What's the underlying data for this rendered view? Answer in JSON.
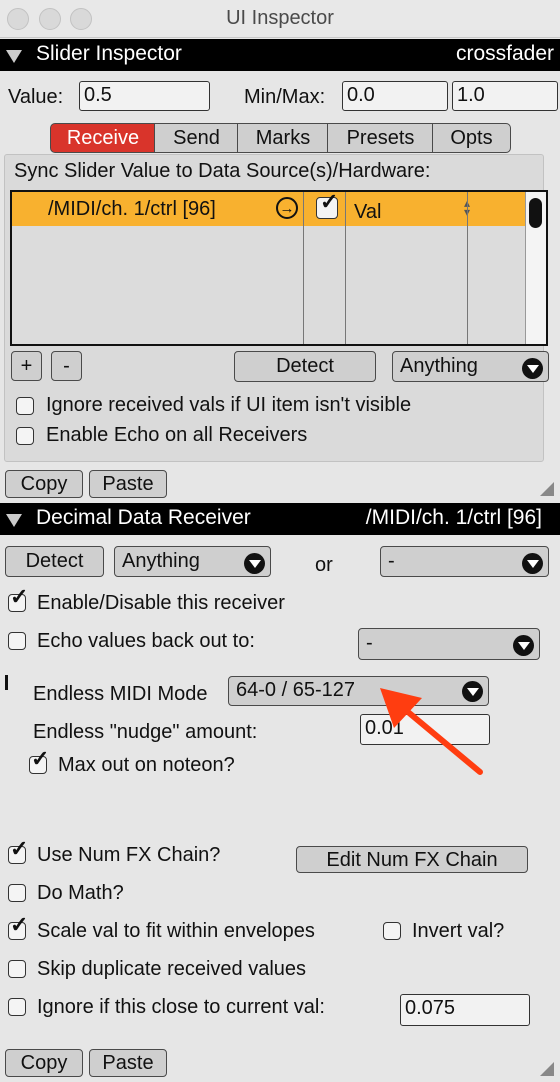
{
  "window": {
    "title": "UI Inspector"
  },
  "slider_inspector": {
    "title": "Slider Inspector",
    "target": "crossfader",
    "value_label": "Value:",
    "value": "0.5",
    "minmax_label": "Min/Max:",
    "min": "0.0",
    "max": "1.0",
    "tabs": [
      "Receive",
      "Send",
      "Marks",
      "Presets",
      "Opts"
    ],
    "selected_tab": "Receive",
    "sync_label": "Sync Slider Value to Data Source(s)/Hardware:",
    "receivers": [
      {
        "source": "/MIDI/ch. 1/ctrl [96]",
        "enabled": true,
        "mode": "Val"
      }
    ],
    "add_label": "+",
    "remove_label": "-",
    "detect_label": "Detect",
    "filter_value": "Anything",
    "ignore_hidden_label": "Ignore received vals if UI item isn't visible",
    "ignore_hidden": false,
    "echo_all_label": "Enable Echo on all Receivers",
    "echo_all": false,
    "copy_label": "Copy",
    "paste_label": "Paste"
  },
  "receiver": {
    "title": "Decimal Data Receiver",
    "source": "/MIDI/ch. 1/ctrl [96]",
    "detect_label": "Detect",
    "filter_value": "Anything",
    "or_label": "or",
    "alt_value": "-",
    "enable_label": "Enable/Disable this receiver",
    "enabled": true,
    "echo_label": "Echo values back out to:",
    "echo": false,
    "echo_value": "-",
    "endless_label": "Endless MIDI Mode",
    "endless_value": "64-0 / 65-127",
    "nudge_label": "Endless \"nudge\" amount:",
    "nudge_value": "0.01",
    "maxout_label": "Max out on noteon?",
    "maxout": true,
    "fx_label": "Use Num FX Chain?",
    "fx": true,
    "edit_fx_label": "Edit Num FX Chain",
    "math_label": "Do Math?",
    "math": false,
    "scale_label": "Scale val to fit within envelopes",
    "scale": true,
    "invert_label": "Invert val?",
    "invert": false,
    "skip_label": "Skip duplicate received values",
    "skip": false,
    "ignore_close_label": "Ignore if this close to current val:",
    "ignore_close": false,
    "ignore_close_value": "0.075",
    "copy_label": "Copy",
    "paste_label": "Paste"
  },
  "colors": {
    "accent": "#d9342b",
    "selected_row": "#f8b12f",
    "annotation_arrow": "#ff3d10"
  }
}
